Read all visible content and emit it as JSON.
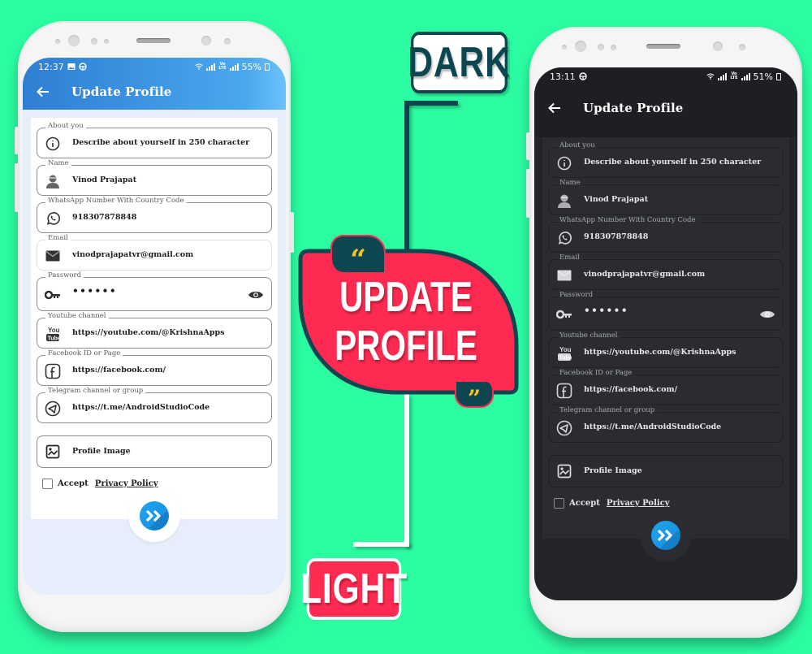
{
  "banner": {
    "dark_tag": "DARK",
    "light_tag": "LIGHT",
    "headline_line1": "UPDATE",
    "headline_line2": "PROFILE",
    "quote_open": "“",
    "quote_close": "”",
    "colors": {
      "background": "#2bfca2",
      "accent_red": "#ff2a51",
      "accent_teal": "#0c4651",
      "quote_yellow": "#f9c51c"
    }
  },
  "light_phone": {
    "status": {
      "time": "12:37",
      "battery": "55%"
    },
    "toolbar": {
      "back_icon": "arrow-left-icon",
      "title": "Update Profile"
    },
    "fields": [
      {
        "label": "About you",
        "icon": "info-icon",
        "value": "Describe about yourself in 250 character"
      },
      {
        "label": "Name",
        "icon": "user-avatar-icon",
        "value": "Vinod Prajapat"
      },
      {
        "label": "WhatsApp Number With Country Code",
        "icon": "whatsapp-icon",
        "value": "918307878848"
      },
      {
        "label": "Email",
        "icon": "mail-icon",
        "value": "vinodprajapatvr@gmail.com"
      },
      {
        "label": "Password",
        "icon": "key-icon",
        "value": "••••••",
        "trailing_icon": "eye-icon"
      },
      {
        "label": "Youtube channel",
        "icon": "youtube-icon",
        "value": "https://youtube.com/@KrishnaApps"
      },
      {
        "label": "Facebook ID or Page",
        "icon": "facebook-icon",
        "value": "https://facebook.com/"
      },
      {
        "label": "Telegram channel or group",
        "icon": "telegram-icon",
        "value": "https://t.me/AndroidStudioCode"
      }
    ],
    "profile_image": {
      "icon": "image-icon",
      "label": "Profile Image"
    },
    "accept": {
      "checked": false,
      "prefix": "Accept",
      "link": "Privacy Policy"
    },
    "submit_icon": "double-chevron-right-icon",
    "colors": {
      "appbar": "#3b91e0",
      "fab": "#1fa3ee",
      "screen_bg": "#e6edfb"
    }
  },
  "dark_phone": {
    "status": {
      "time": "13:11",
      "battery": "51%"
    },
    "toolbar": {
      "back_icon": "arrow-left-icon",
      "title": "Update Profile"
    },
    "fields": [
      {
        "label": "About you",
        "icon": "info-icon",
        "value": "Describe about yourself in 250 character"
      },
      {
        "label": "Name",
        "icon": "user-avatar-icon",
        "value": "Vinod Prajapat"
      },
      {
        "label": "WhatsApp Number With Country Code",
        "icon": "whatsapp-icon",
        "value": "918307878848"
      },
      {
        "label": "Email",
        "icon": "mail-icon",
        "value": "vinodprajapatvr@gmail.com"
      },
      {
        "label": "Password",
        "icon": "key-icon",
        "value": "••••••",
        "trailing_icon": "eye-icon"
      },
      {
        "label": "Youtube channel",
        "icon": "youtube-icon",
        "value": "https://youtube.com/@KrishnaApps"
      },
      {
        "label": "Facebook ID or Page",
        "icon": "facebook-icon",
        "value": "https://facebook.com/"
      },
      {
        "label": "Telegram channel or group",
        "icon": "telegram-icon",
        "value": "https://t.me/AndroidStudioCode"
      }
    ],
    "profile_image": {
      "icon": "image-icon",
      "label": "Profile Image"
    },
    "accept": {
      "checked": false,
      "prefix": "Accept",
      "link": "Privacy Policy"
    },
    "submit_icon": "double-chevron-right-icon",
    "colors": {
      "appbar": "#1d1f23",
      "card": "#2a2c31",
      "fab": "#1fa3ee"
    }
  }
}
